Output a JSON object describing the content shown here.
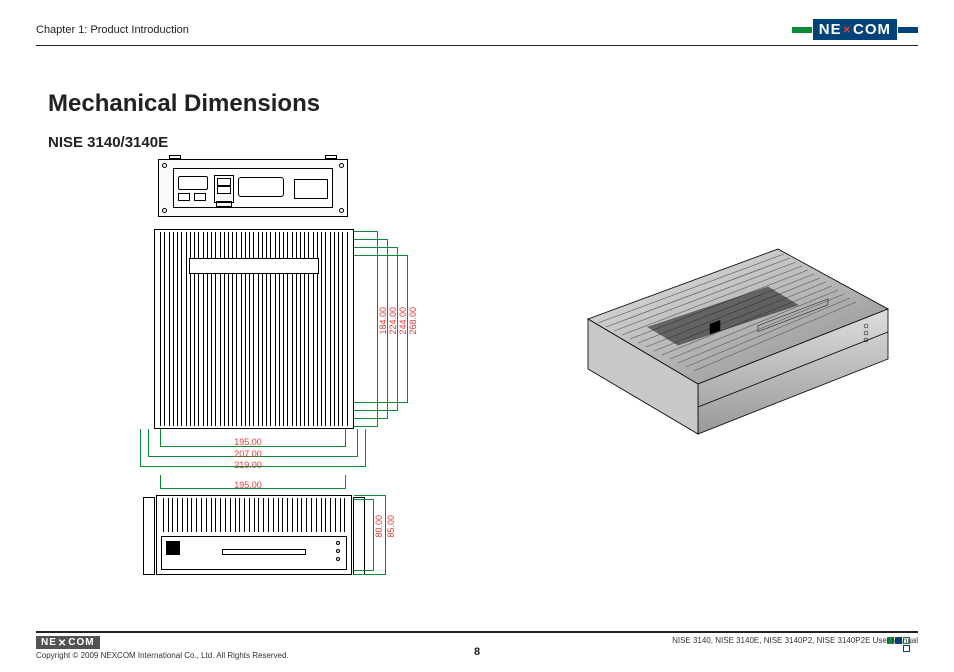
{
  "header": {
    "chapter": "Chapter 1: Product Introduction",
    "logo_text_1": "NE",
    "logo_text_2": "COM"
  },
  "content": {
    "title": "Mechanical Dimensions",
    "subtitle": "NISE 3140/3140E"
  },
  "dimensions": {
    "depth_1": "184.00",
    "depth_2": "224.00",
    "depth_3": "244.00",
    "depth_4": "268.00",
    "width_1": "195.00",
    "width_2": "207.00",
    "width_3": "219.00",
    "width_4": "195.00",
    "height_1": "80.00",
    "height_2": "85.00"
  },
  "footer": {
    "logo_text_1": "NE",
    "logo_text_2": "COM",
    "copyright": "Copyright © 2009 NEXCOM International Co., Ltd. All Rights Reserved.",
    "page_number": "8",
    "manual_ref": "NISE 3140, NISE 3140E, NISE 3140P2, NISE 3140P2E User Manual"
  }
}
